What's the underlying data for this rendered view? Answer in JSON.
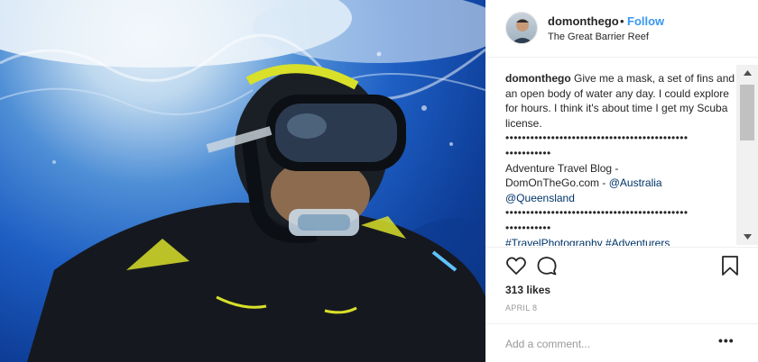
{
  "post": {
    "photo_alt": "underwater snorkeling selfie",
    "author": {
      "username": "domonthego",
      "separator": "•",
      "follow_label": "Follow",
      "location": "The Great Barrier Reef"
    },
    "caption": {
      "username": "domonthego",
      "text": "Give me a mask, a set of fins and an open body of water any day. I could explore for hours. I think it's about time I get my Scuba license.",
      "dots_line_1": "••••••••••••••••••••••••••••••••••••••••••••",
      "dots_line_2": "•••••••••••",
      "blog_line_1": "Adventure Travel Blog -",
      "blog_line_2_text": "DomOnTheGo.com - ",
      "mention_1": "@Australia",
      "mention_2": "@Queensland",
      "dots_line_3": "••••••••••••••••••••••••••••••••••••••••••••",
      "dots_line_4": "•••••••••••",
      "hashtag_1": "#TravelPhotography",
      "hashtag_2": "#Adventurers"
    },
    "likes": "313 likes",
    "date": "APRIL 8",
    "comment_placeholder": "Add a comment...",
    "more_label": "•••"
  },
  "icons": {
    "like": "heart-icon",
    "comment": "comment-icon",
    "save": "bookmark-icon",
    "scroll_up": "chevron-up-icon",
    "scroll_down": "chevron-down-icon"
  },
  "colors": {
    "link_blue": "#3897f0",
    "hashtag_blue": "#003569",
    "ocean_blue": "#1e5fc4",
    "wetsuit_accent": "#d8e02a"
  }
}
